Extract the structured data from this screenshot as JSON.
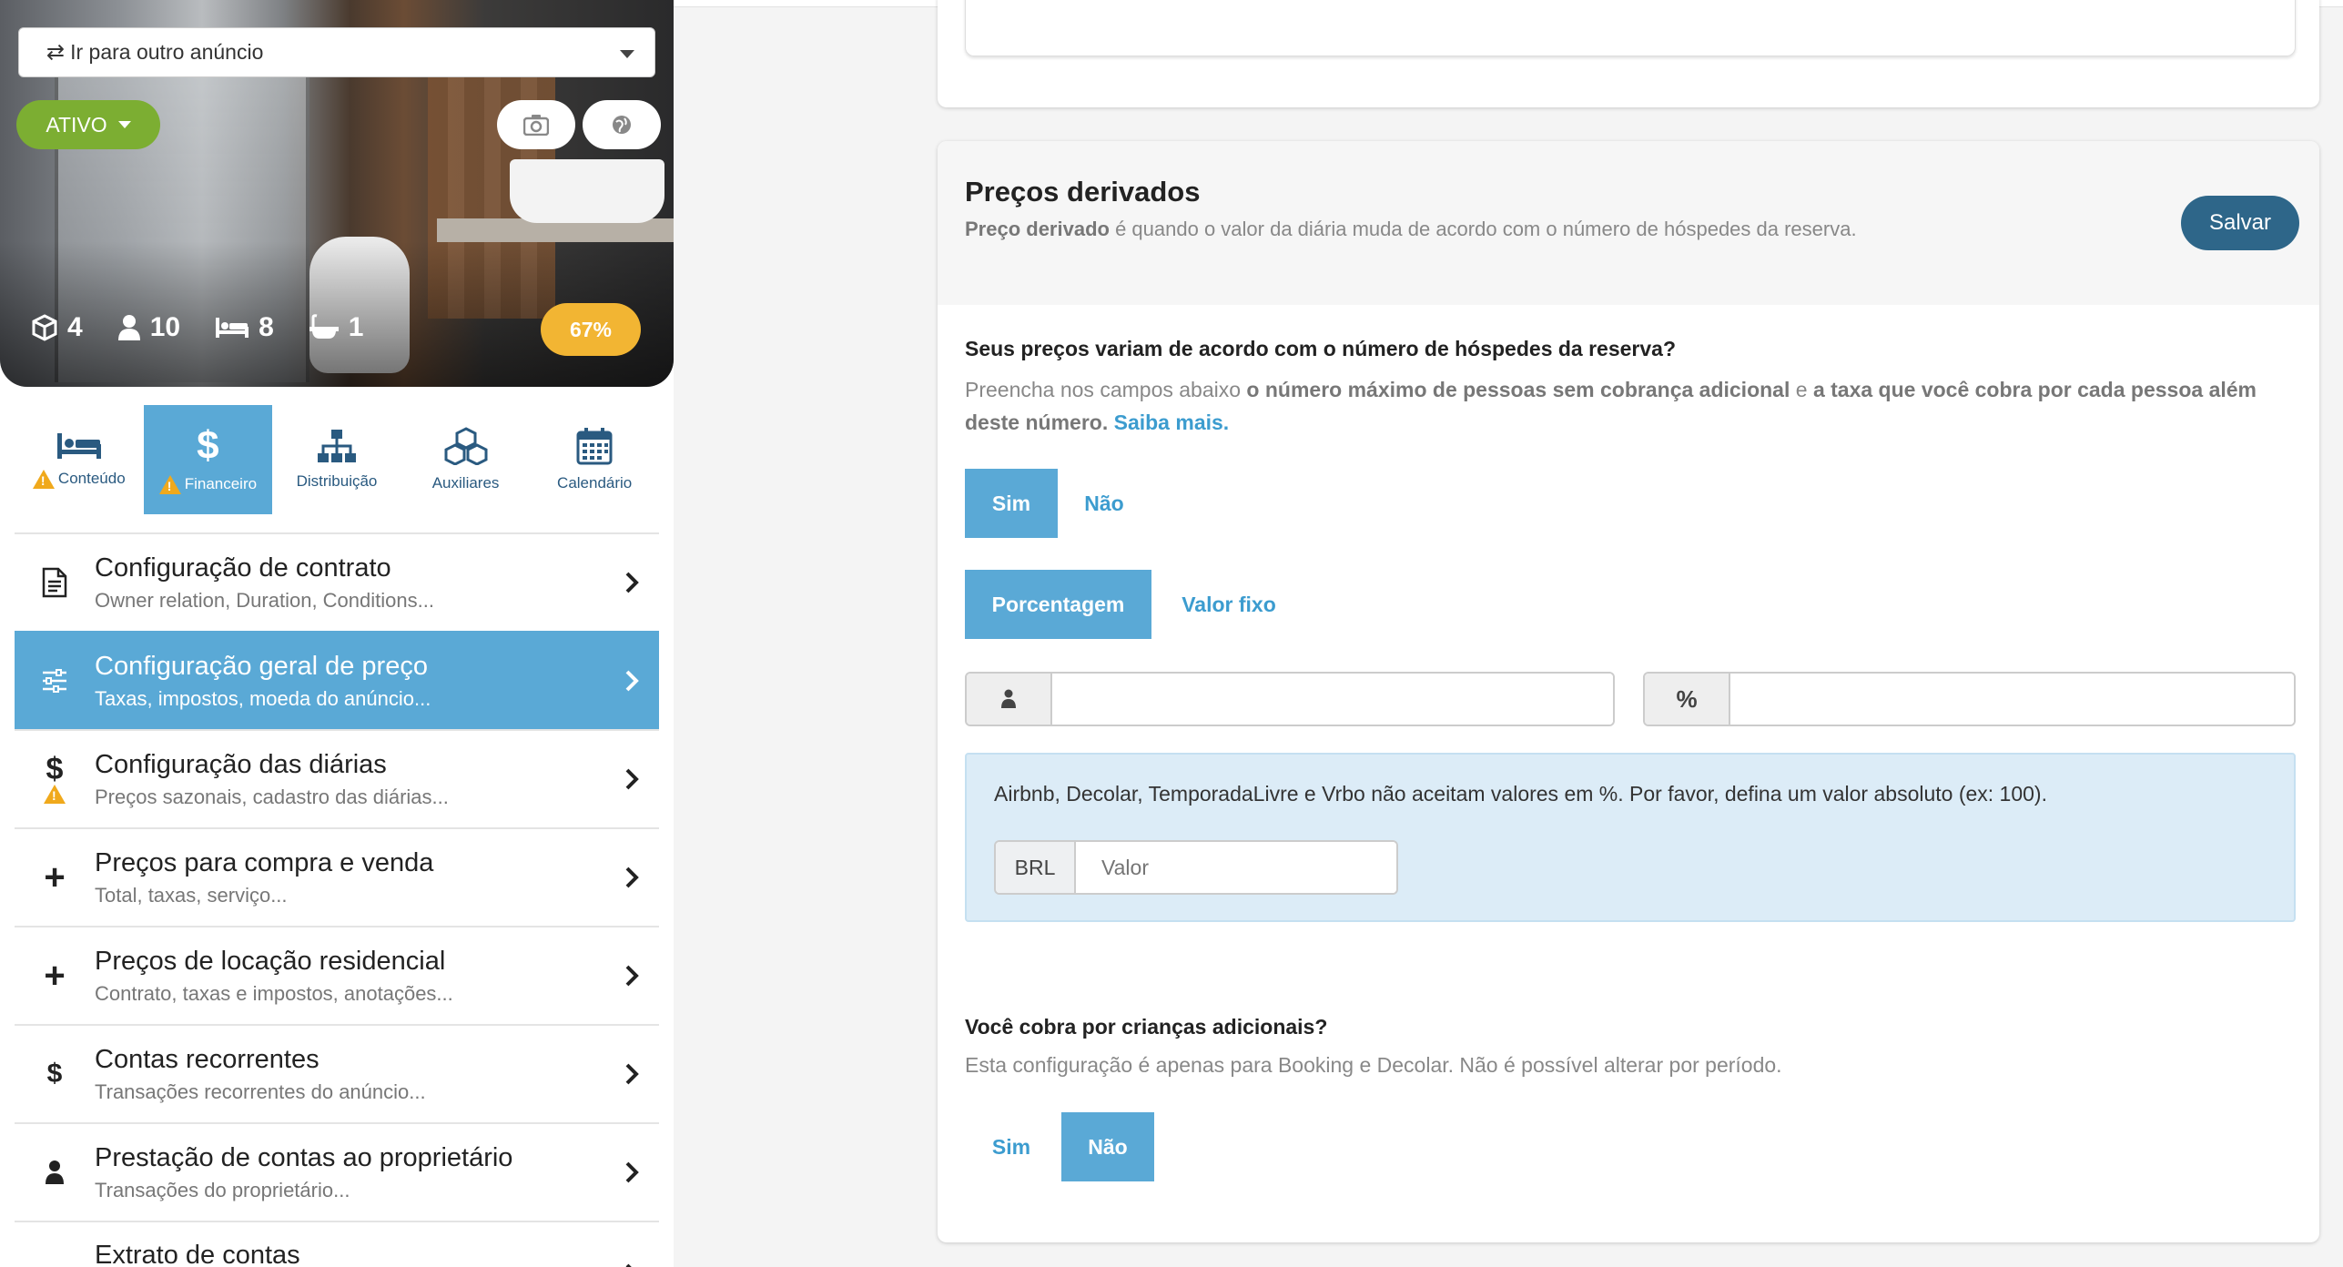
{
  "sidebar": {
    "goto_label": "Ir para outro anúncio",
    "status_label": "ATIVO",
    "stats": {
      "units": "4",
      "guests": "10",
      "beds": "8",
      "baths": "1"
    },
    "completion": "67%",
    "tabs": [
      {
        "label": "Conteúdo",
        "warning": true
      },
      {
        "label": "Financeiro",
        "warning": true,
        "active": true
      },
      {
        "label": "Distribuição"
      },
      {
        "label": "Auxiliares"
      },
      {
        "label": "Calendário"
      }
    ],
    "menu": [
      {
        "title": "Configuração de contrato",
        "subtitle": "Owner relation, Duration, Conditions..."
      },
      {
        "title": "Configuração geral de preço",
        "subtitle": "Taxas, impostos, moeda do anúncio...",
        "active": true
      },
      {
        "title": "Configuração das diárias",
        "subtitle": "Preços sazonais, cadastro das diárias..."
      },
      {
        "title": "Preços para compra e venda",
        "subtitle": "Total, taxas, serviço..."
      },
      {
        "title": "Preços de locação residencial",
        "subtitle": "Contrato, taxas e impostos, anotações..."
      },
      {
        "title": "Contas recorrentes",
        "subtitle": "Transações recorrentes do anúncio..."
      },
      {
        "title": "Prestação de contas ao proprietário",
        "subtitle": "Transações do proprietário..."
      },
      {
        "title": "Extrato de contas",
        "subtitle": ""
      }
    ]
  },
  "main": {
    "title": "Preços derivados",
    "desc_bold": "Preço derivado",
    "desc_rest": " é quando o valor da diária muda de acordo com o número de hóspedes da reserva.",
    "save_label": "Salvar",
    "q1": {
      "title": "Seus preços variam de acordo com o número de hóspedes da reserva?",
      "desc_a": "Preencha nos campos abaixo ",
      "desc_b": "o número máximo de pessoas sem cobrança adicional",
      "desc_c": " e ",
      "desc_d": "a taxa que você cobra por cada pessoa além deste número.",
      "link": "Saiba mais.",
      "yes": "Sim",
      "no": "Não",
      "pct": "Porcentagem",
      "fixed": "Valor fixo",
      "pct_symbol": "%"
    },
    "alert": {
      "text": "Airbnb, Decolar, TemporadaLivre e Vrbo não aceitam valores em %. Por favor, defina um valor absoluto (ex: 100).",
      "currency": "BRL",
      "placeholder": "Valor"
    },
    "q2": {
      "title": "Você cobra por crianças adicionais?",
      "desc": "Esta configuração é apenas para Booking e Decolar. Não é possível alterar por período.",
      "yes": "Sim",
      "no": "Não"
    }
  },
  "colors": {
    "accent": "#5aa9d6",
    "link": "#3c9ccf",
    "save": "#2e6689",
    "status": "#7cae32",
    "badge": "#f2b533",
    "warning": "#f0a91c"
  }
}
